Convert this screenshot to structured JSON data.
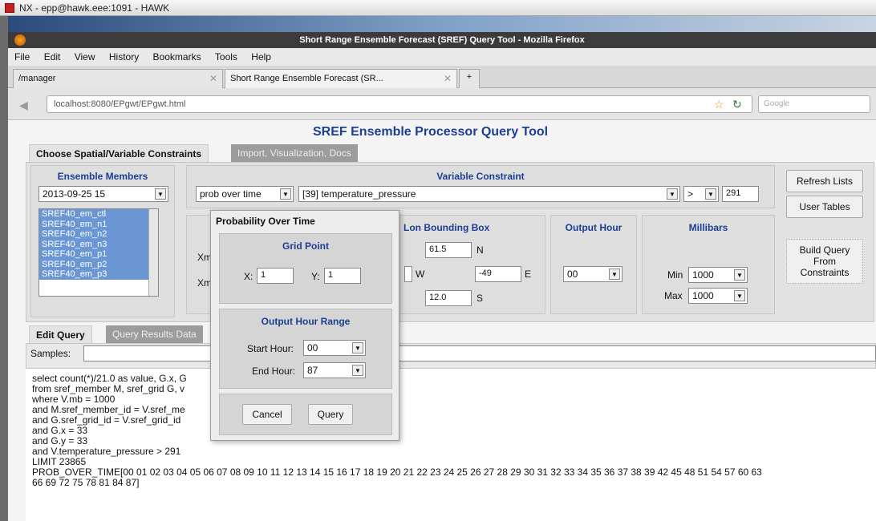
{
  "os_window_title": "NX - epp@hawk.eee:1091 - HAWK",
  "browser_title": "Short Range Ensemble Forecast (SREF) Query Tool - Mozilla Firefox",
  "menu": [
    "File",
    "Edit",
    "View",
    "History",
    "Bookmarks",
    "Tools",
    "Help"
  ],
  "tabs": [
    {
      "label": "/manager"
    },
    {
      "label": "Short Range Ensemble Forecast (SR..."
    }
  ],
  "url": "localhost:8080/EPgwt/EPgwt.html",
  "search_placeholder": "Google",
  "page_title": "SREF Ensemble Processor Query Tool",
  "top_tabs": {
    "active": "Choose Spatial/Variable Constraints",
    "inactive": "Import, Visualization, Docs"
  },
  "ensemble": {
    "header": "Ensemble Members",
    "date": "2013-09-25 15",
    "members": [
      "SREF40_em_ctl",
      "SREF40_em_n1",
      "SREF40_em_n2",
      "SREF40_em_n3",
      "SREF40_em_p1",
      "SREF40_em_p2",
      "SREF40_em_p3"
    ]
  },
  "variable": {
    "header": "Variable Constraint",
    "function": "prob over time",
    "variable": "[39] temperature_pressure",
    "operator": ">",
    "value": "291"
  },
  "bbox": {
    "header": "Lon Bounding Box",
    "n_val": "61.5",
    "n": "N",
    "e_val": "-49",
    "e": "E",
    "w": "W",
    "s_val": "12.0",
    "s": "S",
    "xm1": "Xm",
    "xm2": "Xm"
  },
  "output_hour": {
    "header": "Output Hour",
    "value": "00"
  },
  "millibars": {
    "header": "Millibars",
    "min_label": "Min",
    "min": "1000",
    "max_label": "Max",
    "max": "1000"
  },
  "buttons": {
    "refresh": "Refresh Lists",
    "user_tables": "User Tables",
    "build": "Build Query From Constraints"
  },
  "lower_tabs": {
    "active": "Edit Query",
    "inactive": "Query Results Data"
  },
  "samples_label": "Samples:",
  "dialog": {
    "title": "Probability Over Time",
    "grid_header": "Grid Point",
    "x_label": "X:",
    "x_value": "1",
    "y_label": "Y:",
    "y_value": "1",
    "range_header": "Output Hour Range",
    "start_label": "Start Hour:",
    "start_value": "00",
    "end_label": "End Hour:",
    "end_value": "87",
    "cancel": "Cancel",
    "query": "Query"
  },
  "query_lines": [
    "select count(*)/21.0 as value, G.x, G",
    "from sref_member M, sref_grid G, v",
    "where V.mb = 1000",
    "and M.sref_member_id = V.sref_me",
    "and G.sref_grid_id = V.sref_grid_id",
    "and G.x = 33",
    "and G.y = 33",
    "and V.temperature_pressure > 291",
    "LIMIT 23865",
    "PROB_OVER_TIME[00 01 02 03 04 05 06 07 08 09 10 11 12 13 14 15 16 17 18 19 20 21 22 23 24 25 26 27 28 29 30 31 32 33 34 35 36 37 38 39 42 45 48 51 54 57 60 63",
    "66 69 72 75 78 81 84 87]"
  ]
}
